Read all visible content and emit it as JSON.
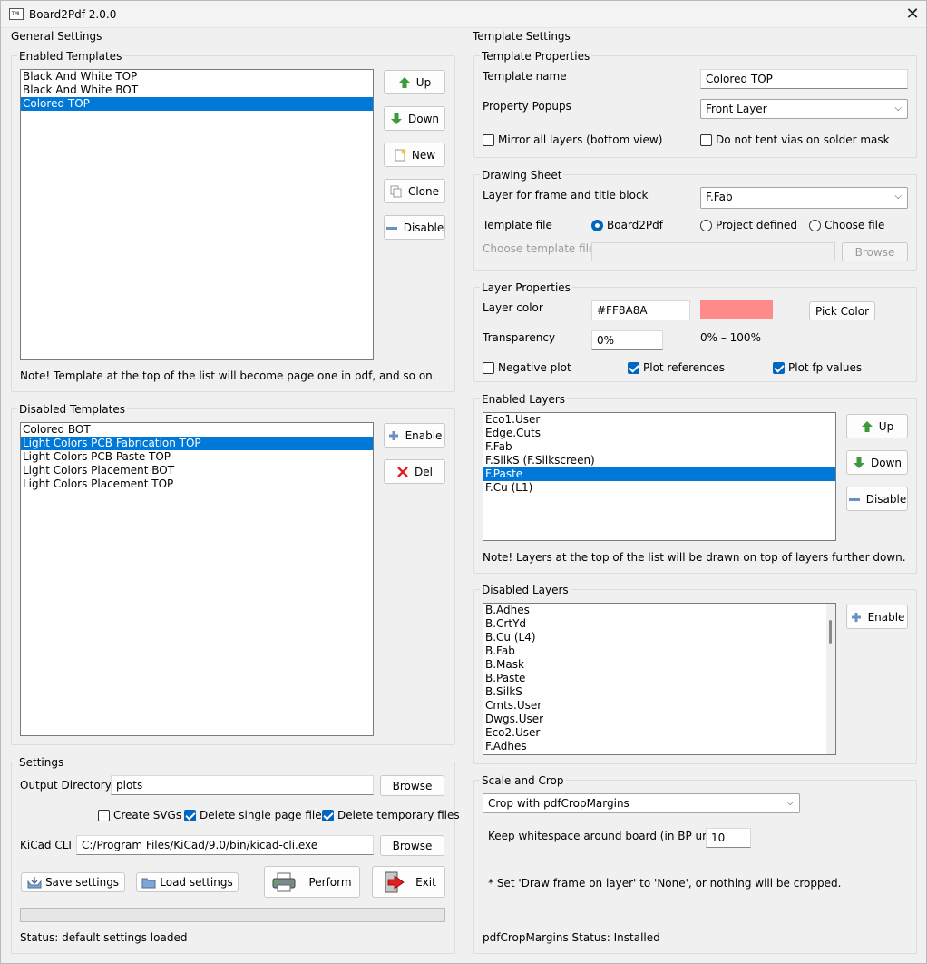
{
  "window": {
    "title": "Board2Pdf 2.0.0",
    "icon_label": "TML"
  },
  "general": {
    "heading": "General Settings",
    "enabled_templates": {
      "heading": "Enabled Templates",
      "items": [
        "Black And White TOP",
        "Black And White BOT",
        "Colored TOP"
      ],
      "selected_index": 2,
      "note": "Note! Template at the top of the list will become page one in pdf, and so on.",
      "buttons": {
        "up": "Up",
        "down": "Down",
        "new": "New",
        "clone": "Clone",
        "disable": "Disable"
      }
    },
    "disabled_templates": {
      "heading": "Disabled Templates",
      "items": [
        "Colored BOT",
        "Light Colors PCB Fabrication TOP",
        "Light Colors PCB Paste TOP",
        "Light Colors Placement BOT",
        "Light Colors Placement TOP"
      ],
      "selected_index": 1,
      "buttons": {
        "enable": "Enable",
        "del": "Del"
      }
    },
    "settings": {
      "heading": "Settings",
      "output_dir_label": "Output Directory",
      "output_dir_value": "plots",
      "browse": "Browse",
      "create_svgs": "Create SVGs",
      "create_svgs_checked": false,
      "delete_single": "Delete single page files",
      "delete_single_checked": true,
      "delete_temp": "Delete temporary files",
      "delete_temp_checked": true,
      "kicad_cli_label": "KiCad CLI",
      "kicad_cli_value": "C:/Program Files/KiCad/9.0/bin/kicad-cli.exe",
      "browse2": "Browse",
      "save_settings": "Save settings",
      "load_settings": "Load settings",
      "perform": "Perform",
      "exit": "Exit",
      "progress": 0,
      "status": "Status: default settings loaded"
    }
  },
  "template": {
    "heading": "Template Settings",
    "properties": {
      "heading": "Template Properties",
      "name_label": "Template name",
      "name_value": "Colored TOP",
      "popups_label": "Property Popups",
      "popups_value": "Front Layer",
      "mirror_label": "Mirror all layers (bottom view)",
      "mirror_checked": false,
      "tent_label": "Do not tent vias on solder mask",
      "tent_checked": false
    },
    "drawing_sheet": {
      "heading": "Drawing Sheet",
      "frame_label": "Layer for frame and title block",
      "frame_value": "F.Fab",
      "template_file_label": "Template file",
      "radio_board2pdf": "Board2Pdf",
      "radio_project": "Project defined",
      "radio_choose": "Choose file",
      "selected_radio": "board2pdf",
      "choose_label": "Choose template file",
      "choose_value": "",
      "browse": "Browse"
    },
    "layer_properties": {
      "heading": "Layer Properties",
      "color_label": "Layer color",
      "color_value": "#FF8A8A",
      "swatch_color": "#FF8A8A",
      "pick_color": "Pick Color",
      "transparency_label": "Transparency",
      "transparency_value": "0%",
      "transparency_range": "0% – 100%",
      "negative_plot": "Negative plot",
      "negative_checked": false,
      "plot_refs": "Plot references",
      "plot_refs_checked": true,
      "plot_fp": "Plot fp values",
      "plot_fp_checked": true
    },
    "enabled_layers": {
      "heading": "Enabled Layers",
      "items": [
        "Eco1.User",
        "Edge.Cuts",
        "F.Fab",
        "F.SilkS (F.Silkscreen)",
        "F.Paste",
        "F.Cu (L1)"
      ],
      "selected_index": 4,
      "note": "Note! Layers at the top of the list will be drawn on top of layers further down.",
      "buttons": {
        "up": "Up",
        "down": "Down",
        "disable": "Disable"
      }
    },
    "disabled_layers": {
      "heading": "Disabled Layers",
      "items": [
        "B.Adhes",
        "B.CrtYd",
        "B.Cu (L4)",
        "B.Fab",
        "B.Mask",
        "B.Paste",
        "B.SilkS",
        "Cmts.User",
        "Dwgs.User",
        "Eco2.User",
        "F.Adhes"
      ],
      "buttons": {
        "enable": "Enable"
      }
    },
    "scale_crop": {
      "heading": "Scale and Crop",
      "crop_value": "Crop with pdfCropMargins",
      "whitespace_label": "Keep whitespace around board (in BP units)",
      "whitespace_value": "10",
      "note": "* Set 'Draw frame on layer' to 'None', or nothing will be cropped.",
      "status": "pdfCropMargins Status: Installed"
    }
  }
}
